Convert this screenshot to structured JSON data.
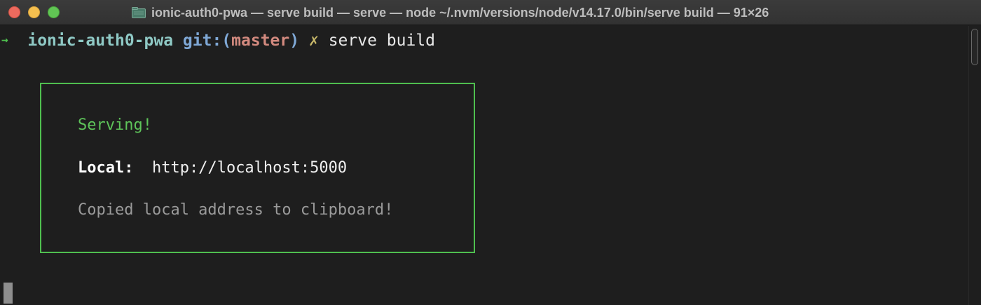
{
  "window": {
    "title": "ionic-auth0-pwa — serve build — serve — node ~/.nvm/versions/node/v14.17.0/bin/serve build — 91×26",
    "folder_icon": "folder-icon"
  },
  "prompt": {
    "arrow": "→",
    "repo": "ionic-auth0-pwa",
    "git_prefix": "git:(",
    "branch": "master",
    "git_suffix": ")",
    "dirty_mark": "✗",
    "command": "serve build"
  },
  "serve_box": {
    "status": "Serving!",
    "local_label": "Local:",
    "local_url": "http://localhost:5000",
    "clipboard_message": "Copied local address to clipboard!"
  },
  "colors": {
    "background": "#1e1e1e",
    "accent_green": "#4fbf4f",
    "branch": "#d38a7f"
  }
}
